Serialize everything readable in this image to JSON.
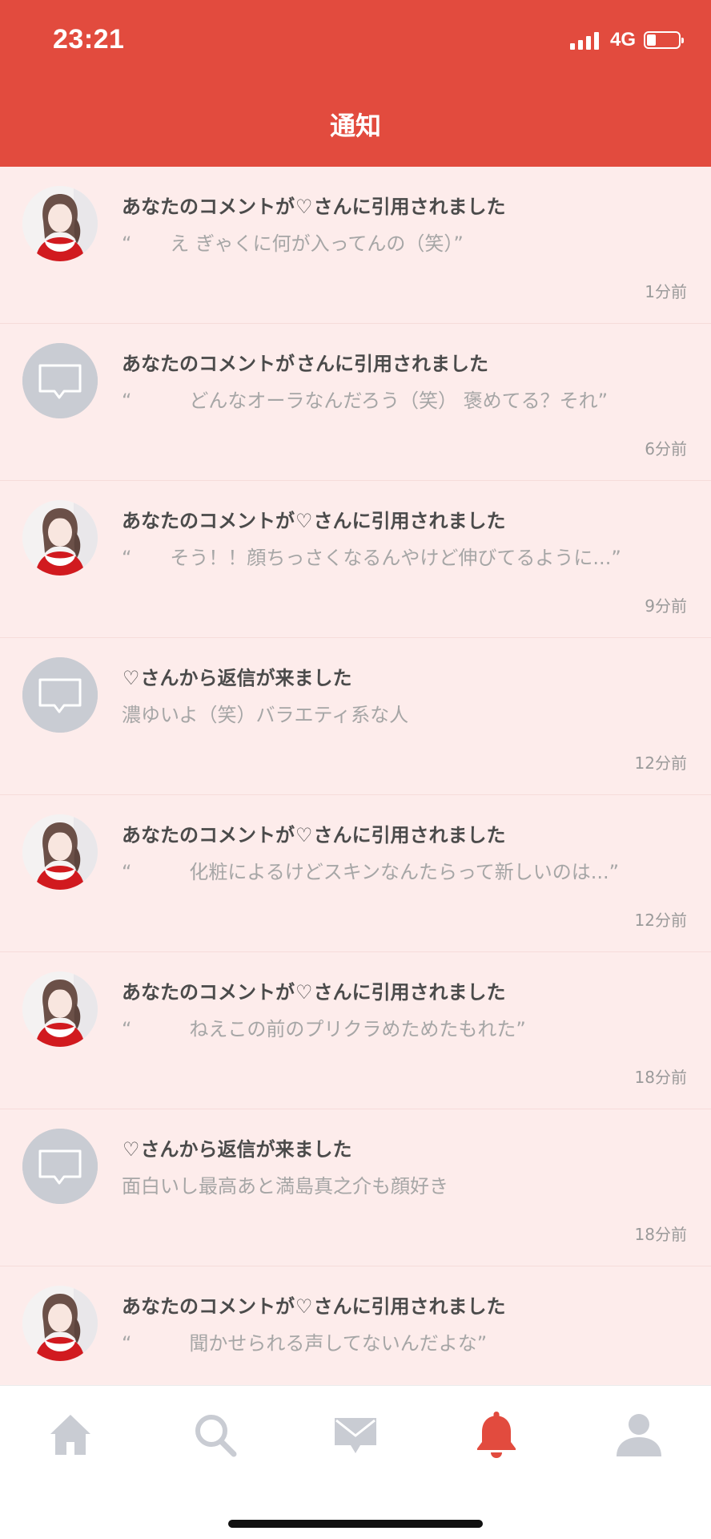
{
  "status_bar": {
    "time": "23:21",
    "network": "4G",
    "battery_level": 0.3
  },
  "header": {
    "title": "通知"
  },
  "notifications": [
    {
      "avatar": "photo",
      "title_before": "あなたのコメントが",
      "heart": "♡",
      "title_after": "さんに引用されました",
      "preview": "“　　え ぎゃくに何が入ってんの（笑）”",
      "time": "1分前"
    },
    {
      "avatar": "default",
      "title_before": "あなたのコメントが",
      "heart": "",
      "title_after": "さんに引用されました",
      "preview": "“　　　どんなオーラなんだろう（笑） 褒めてる？それ”",
      "time": "6分前"
    },
    {
      "avatar": "photo",
      "title_before": "あなたのコメントが",
      "heart": "♡",
      "title_after": "さんに引用されました",
      "preview": "“　　そう！！顔ちっさくなるんやけど伸びてるように...”",
      "time": "9分前"
    },
    {
      "avatar": "default",
      "title_before": "",
      "heart": "♡",
      "title_after": "さんから返信が来ました",
      "preview": "濃ゆいよ（笑）バラエティ系な人",
      "time": "12分前"
    },
    {
      "avatar": "photo",
      "title_before": "あなたのコメントが",
      "heart": "♡",
      "title_after": "さんに引用されました",
      "preview": "“　　　化粧によるけどスキンなんたらって新しいのは...”",
      "time": "12分前"
    },
    {
      "avatar": "photo",
      "title_before": "あなたのコメントが",
      "heart": "♡",
      "title_after": "さんに引用されました",
      "preview": "“　　　ねえこの前のプリクラめためたもれた”",
      "time": "18分前"
    },
    {
      "avatar": "default",
      "title_before": "",
      "heart": "♡",
      "title_after": "さんから返信が来ました",
      "preview": "面白いし最高あと満島真之介も顔好き",
      "time": "18分前"
    },
    {
      "avatar": "photo",
      "title_before": "あなたのコメントが",
      "heart": "♡",
      "title_after": "さんに引用されました",
      "preview": "“　　　聞かせられる声してないんだよな”",
      "time": ""
    }
  ],
  "bottom_nav": [
    {
      "icon": "home-icon",
      "active": false
    },
    {
      "icon": "search-icon",
      "active": false
    },
    {
      "icon": "mail-icon",
      "active": false
    },
    {
      "icon": "bell-icon",
      "active": true
    },
    {
      "icon": "profile-icon",
      "active": false
    }
  ],
  "colors": {
    "accent": "#e24b3e",
    "background": "#fdeceb",
    "inactive_icon": "#c9ccd3",
    "title_text": "#4b4b4b",
    "preview_text": "#a6a6a6"
  }
}
